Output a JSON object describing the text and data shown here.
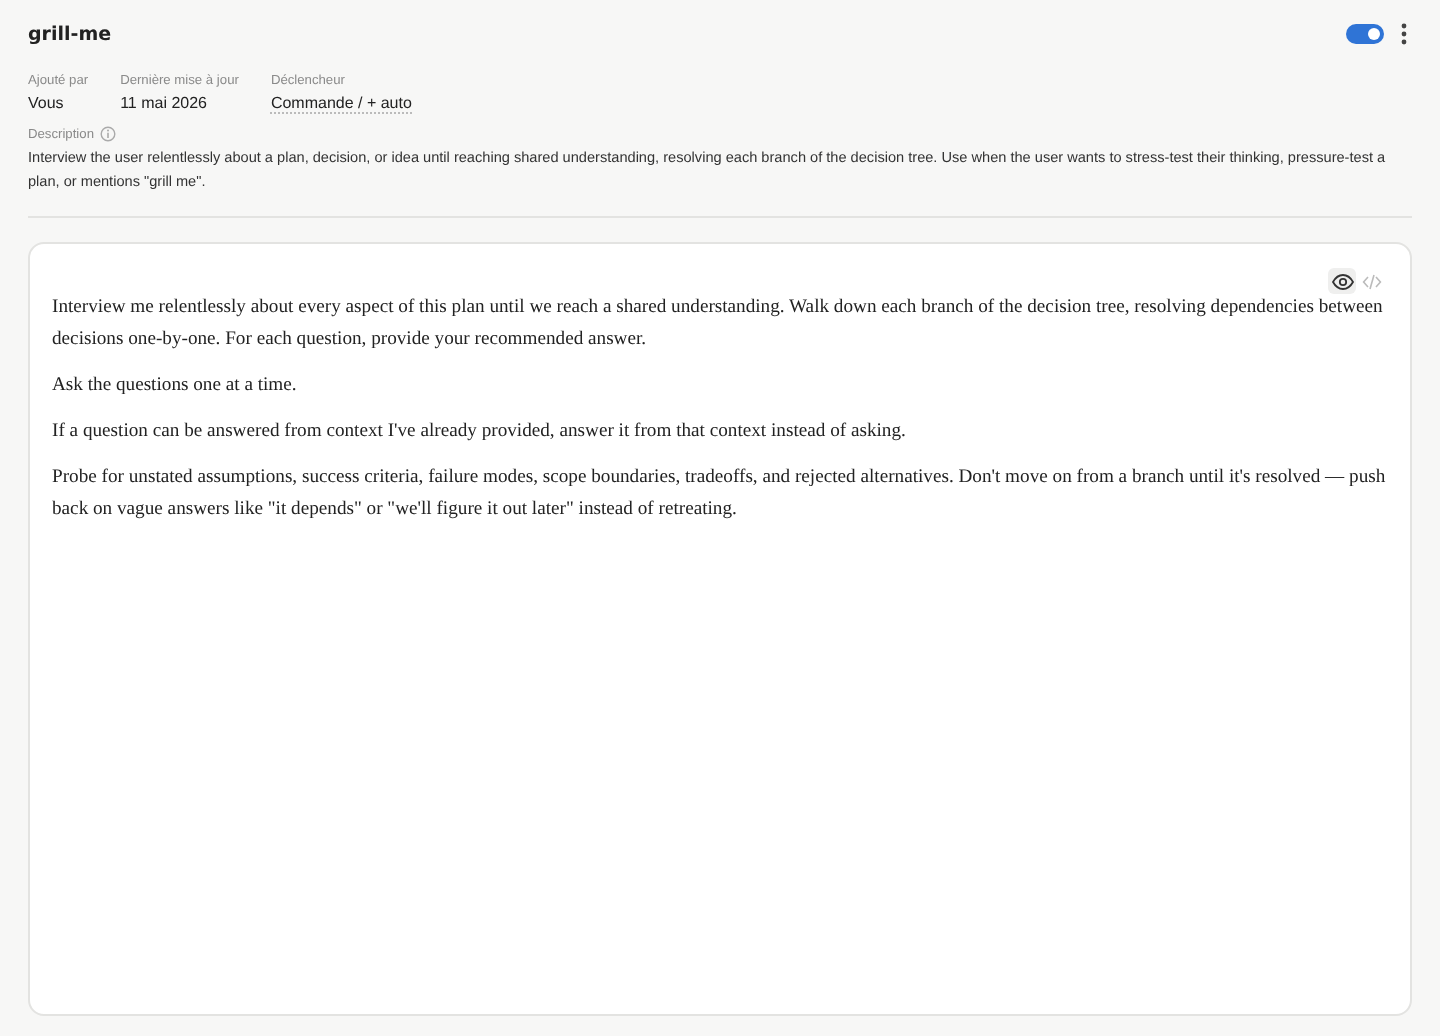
{
  "title": "grill-me",
  "enabled": true,
  "meta": [
    {
      "label": "Ajouté par",
      "value": "Vous",
      "kind": "plain"
    },
    {
      "label": "Dernière mise à jour",
      "value": "11 mai 2026",
      "kind": "plain"
    },
    {
      "label": "Déclencheur",
      "value": "Commande / + auto",
      "kind": "underlined"
    }
  ],
  "description": {
    "label": "Description",
    "text": "Interview the user relentlessly about a plan, decision, or idea until reaching shared understanding, resolving each branch of the decision tree. Use when the user wants to stress-test their thinking, pressure-test a plan, or mentions \"grill me\"."
  },
  "views": [
    {
      "kind": "preview",
      "selected": true
    },
    {
      "kind": "code",
      "selected": false
    }
  ],
  "content": [
    "Interview me relentlessly about every aspect of this plan until we reach a shared understanding. Walk down each branch of the decision tree, resolving dependencies between decisions one-by-one. For each question, provide your recommended answer.",
    "Ask the questions one at a time.",
    "If a question can be answered from context I've already provided, answer it from that context instead of asking.",
    "Probe for unstated assumptions, success criteria, failure modes, scope boundaries, tradeoffs, and rejected alternatives. Don't move on from a branch until it's resolved — push back on vague answers like \"it depends\" or \"we'll figure it out later\" instead of retreating."
  ]
}
